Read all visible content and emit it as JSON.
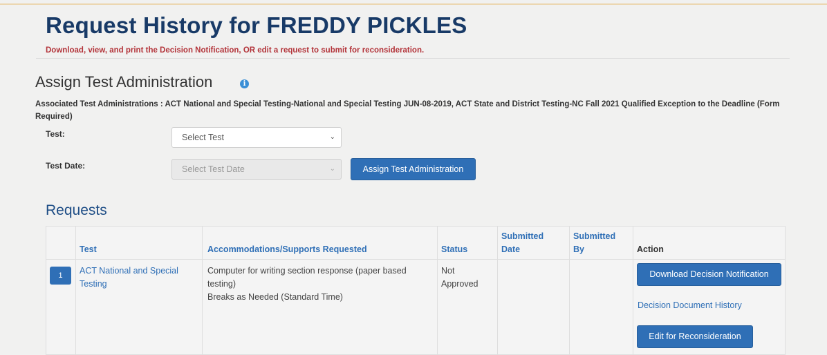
{
  "header": {
    "title": "Request History for FREDDY PICKLES",
    "subtitle": "Download, view, and print the Decision Notification, OR edit a request to submit for reconsideration."
  },
  "assign": {
    "title": "Assign Test Administration",
    "info_icon": "info-icon",
    "associated_text": "Associated Test Administrations : ACT National and Special Testing-National and Special Testing JUN-08-2019, ACT State and District Testing-NC Fall 2021 Qualified Exception to the Deadline (Form Required)",
    "test_label": "Test:",
    "test_select": "Select Test",
    "date_label": "Test Date:",
    "date_select": "Select Test Date",
    "assign_button": "Assign Test Administration"
  },
  "requests": {
    "title": "Requests",
    "columns": {
      "test": "Test",
      "accommodations": "Accommodations/Supports Requested",
      "status": "Status",
      "submitted_date_1": "Submitted",
      "submitted_date_2": "Date",
      "submitted_by_1": "Submitted",
      "submitted_by_2": "By",
      "action": "Action"
    },
    "rows": [
      {
        "number": "1",
        "test_line1": "ACT National and Special",
        "test_line2": "Testing",
        "accommodation_1_line1": "Computer for writing section response (paper based",
        "accommodation_1_line2": "testing)",
        "accommodation_2": "Breaks as Needed (Standard Time)",
        "status_line1": "Not",
        "status_line2": "Approved",
        "submitted_date": "",
        "submitted_by": "",
        "download_button": "Download Decision Notification",
        "history_link": "Decision Document History",
        "edit_button": "Edit for Reconsideration"
      }
    ]
  },
  "colors": {
    "title": "#183a67",
    "subtitle": "#b3343a",
    "accent": "#2f6fb6",
    "background": "#f1f1f0"
  }
}
